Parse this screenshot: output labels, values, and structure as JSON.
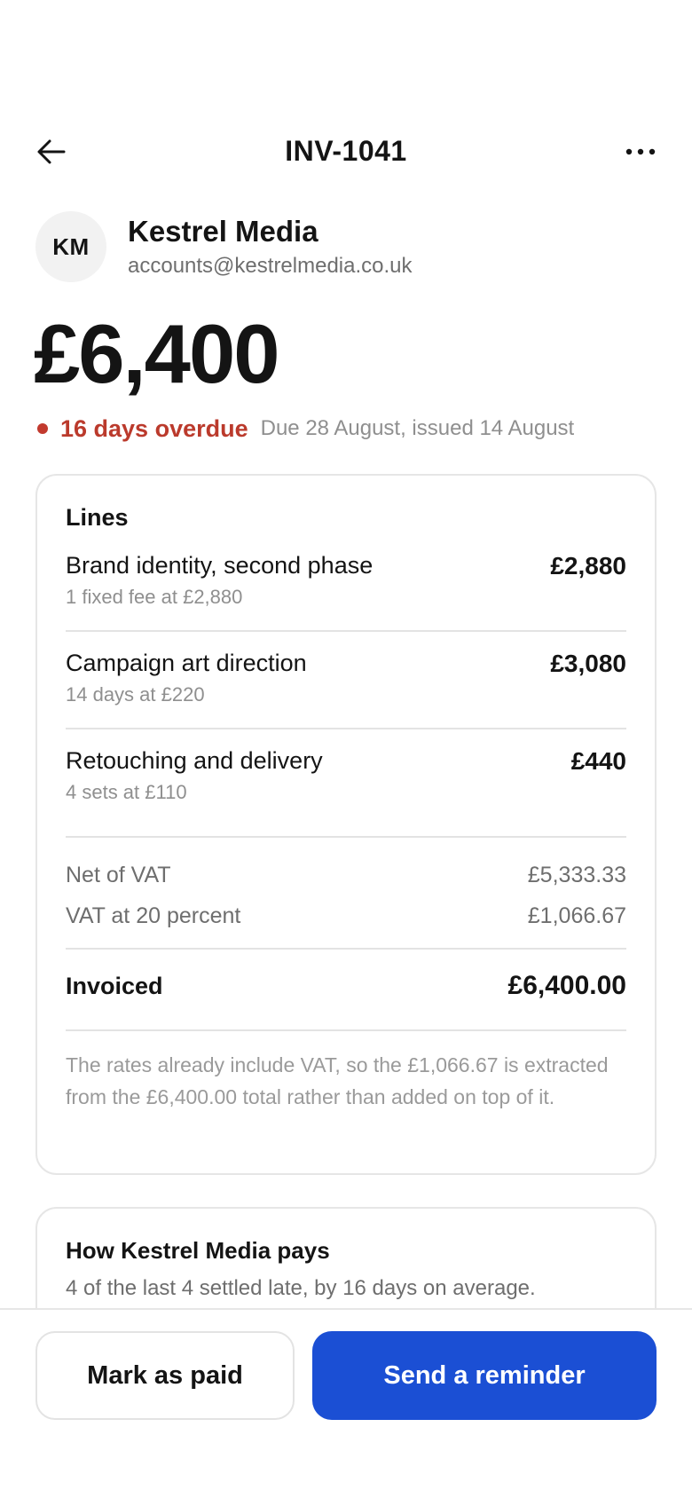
{
  "header": {
    "title": "INV-1041",
    "back_icon": "arrow-left-icon",
    "more_icon": "more-horizontal-icon"
  },
  "client": {
    "initials": "KM",
    "name": "Kestrel Media",
    "email": "accounts@kestrelmedia.co.uk"
  },
  "invoice": {
    "amount": "£6,400",
    "status": "16 days overdue",
    "dates": "Due 28 August, issued 14 August",
    "status_color": "#bb3a2c"
  },
  "lines_card": {
    "heading": "Lines",
    "items": [
      {
        "name": "Brand identity, second phase",
        "detail": "1 fixed fee at £2,880",
        "amount": "£2,880"
      },
      {
        "name": "Campaign art direction",
        "detail": "14 days at £220",
        "amount": "£3,080"
      },
      {
        "name": "Retouching and delivery",
        "detail": "4 sets at £110",
        "amount": "£440"
      }
    ],
    "net_label": "Net of VAT",
    "net_value": "£5,333.33",
    "vat_label": "VAT at 20 percent",
    "vat_value": "£1,066.67",
    "total_label": "Invoiced",
    "total_value": "£6,400.00",
    "note": "The rates already include VAT, so the £1,066.67 is extracted from the £6,400.00 total rather than added on top of it."
  },
  "pays_card": {
    "heading": "How Kestrel Media pays",
    "text": "4 of the last 4 settled late, by 16 days on average."
  },
  "actions": {
    "mark_paid": "Mark as paid",
    "send_reminder": "Send a reminder",
    "primary_color": "#1b4fd4"
  }
}
